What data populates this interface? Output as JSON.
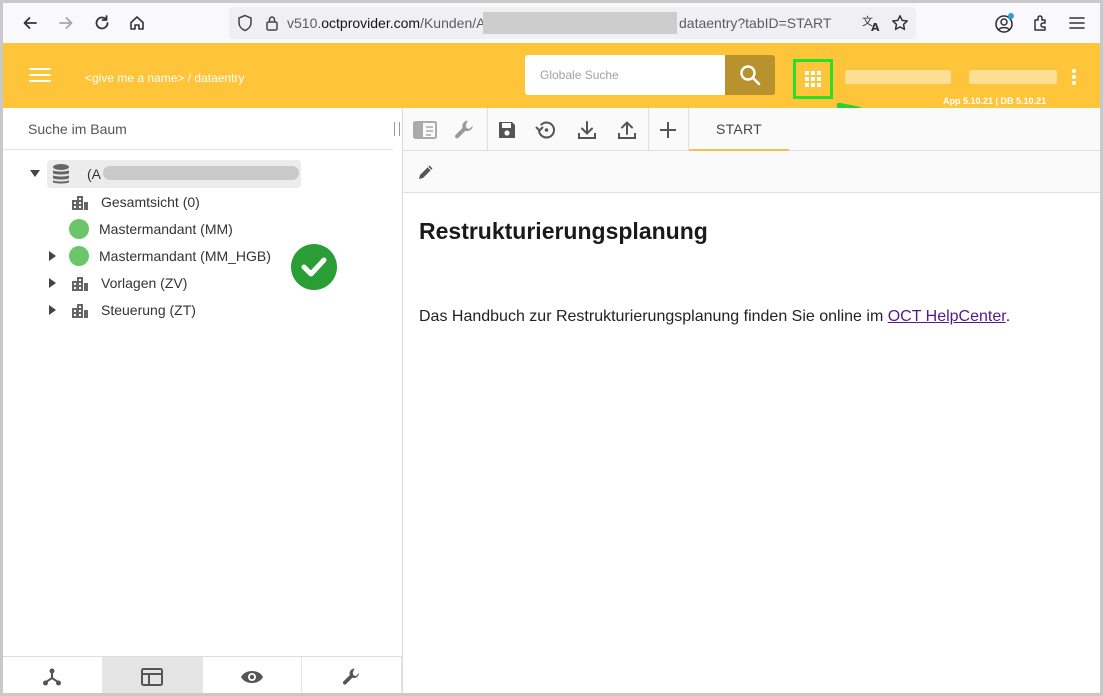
{
  "browser": {
    "url_host_prefix": "v510.",
    "url_host": "octprovider.com",
    "url_path_start": "/Kunden/A",
    "url_path_end": "dataentry?tabID=START"
  },
  "header": {
    "breadcrumb": "<give me a name> / dataentry",
    "search_placeholder": "Globale Suche",
    "version": "App 5.10.21 | DB 5.10.21",
    "accent_color": "#fec43a"
  },
  "tree": {
    "search_placeholder": "Suche im Baum",
    "root_label": "(A",
    "nodes": [
      {
        "label": "Gesamtsicht (0)",
        "icon": "buildings-icon",
        "expandable": false
      },
      {
        "label": "Mastermandant (MM)",
        "icon": "green-dot",
        "expandable": false
      },
      {
        "label": "Mastermandant (MM_HGB)",
        "icon": "green-dot",
        "expandable": true
      },
      {
        "label": "Vorlagen (ZV)",
        "icon": "buildings-icon",
        "expandable": true
      },
      {
        "label": "Steuerung (ZT)",
        "icon": "buildings-icon",
        "expandable": true
      }
    ]
  },
  "bottom_tabs": [
    "hierarchy-icon",
    "layout-icon",
    "eye-icon",
    "wrench-icon"
  ],
  "toolbar": {
    "tab_label": "START",
    "icons": [
      "panel-icon",
      "wrench-icon",
      "save-icon",
      "history-icon",
      "download-icon",
      "upload-icon",
      "plus-icon"
    ]
  },
  "content": {
    "title": "Restrukturierungsplanung",
    "text_before": "Das Handbuch zur Restrukturierungsplanung finden Sie online im ",
    "link_text": "OCT HelpCenter",
    "text_after": "."
  }
}
